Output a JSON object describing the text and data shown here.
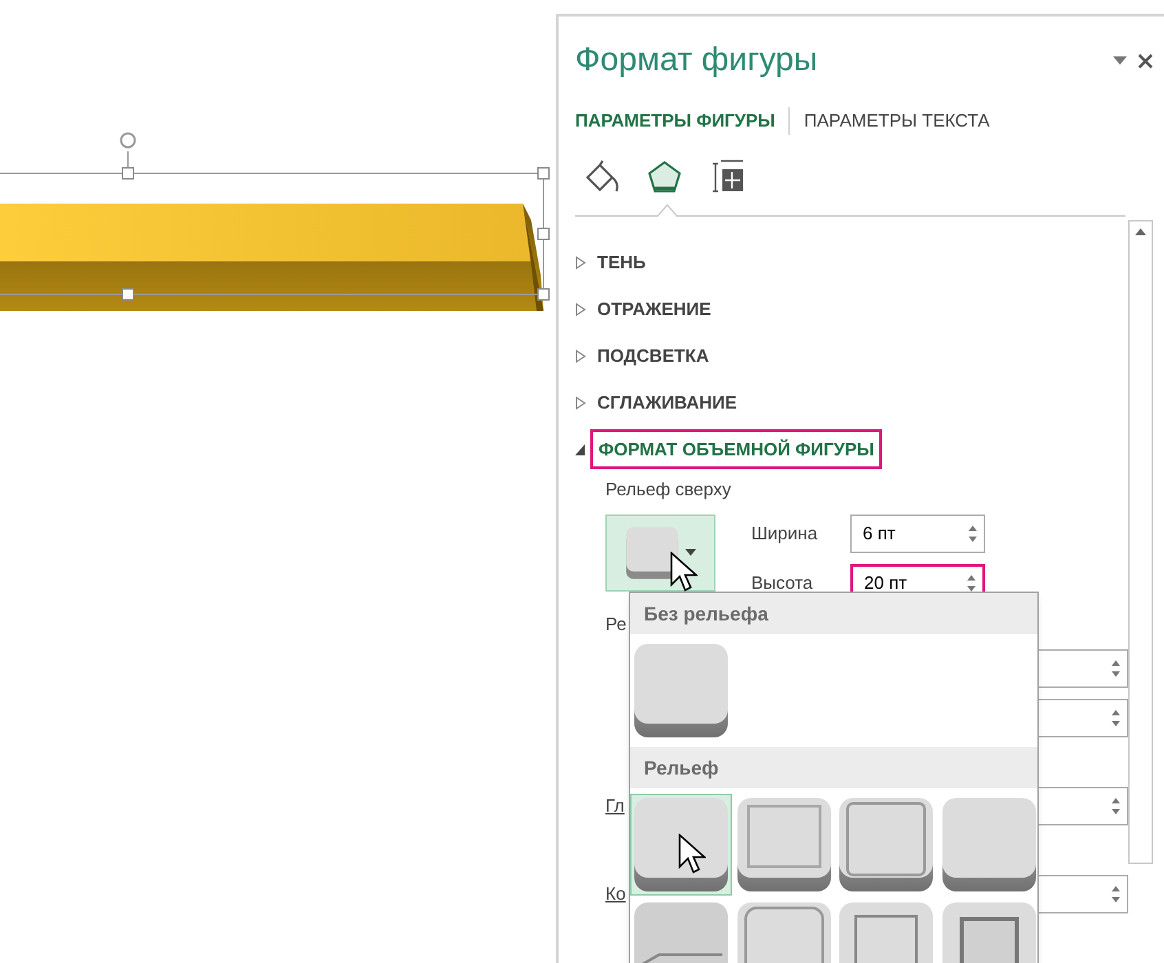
{
  "pane": {
    "title": "Формат фигуры",
    "tabs": [
      {
        "label": "ПАРАМЕТРЫ ФИГУРЫ",
        "selected": true
      },
      {
        "label": "ПАРАМЕТРЫ ТЕКСТА",
        "selected": false
      }
    ],
    "icon_tabs": [
      {
        "kind": "fill",
        "selected": false
      },
      {
        "kind": "effects",
        "selected": true
      },
      {
        "kind": "size",
        "selected": false
      }
    ],
    "sections": [
      {
        "label": "ТЕНЬ",
        "expanded": false,
        "highlighted": false
      },
      {
        "label": "ОТРАЖЕНИЕ",
        "expanded": false,
        "highlighted": false
      },
      {
        "label": "ПОДСВЕТКА",
        "expanded": false,
        "highlighted": false
      },
      {
        "label": "СГЛАЖИВАНИЕ",
        "expanded": false,
        "highlighted": false
      },
      {
        "label": "ФОРМАТ ОБЪЕМНОЙ ФИГУРЫ",
        "expanded": true,
        "highlighted": true
      }
    ],
    "bevel_top": {
      "label": "Рельеф сверху",
      "width_label": "Ширина",
      "width_value": "6 пт",
      "height_label": "Высота",
      "height_value": "20 пт",
      "height_highlighted": true
    },
    "cut_labels": [
      "Ре",
      "Гл",
      "Ко"
    ],
    "gallery": {
      "groups": [
        {
          "title": "Без рельефа",
          "items": [
            {
              "kind": "flat",
              "selected": false
            }
          ]
        },
        {
          "title": "Рельеф",
          "items": [
            {
              "kind": "round",
              "selected": true
            },
            {
              "kind": "inset",
              "selected": false
            },
            {
              "kind": "step",
              "selected": false
            },
            {
              "kind": "soft",
              "selected": false
            },
            {
              "kind": "angle",
              "selected": false
            },
            {
              "kind": "convex",
              "selected": false
            },
            {
              "kind": "frame",
              "selected": false
            },
            {
              "kind": "deep",
              "selected": false
            }
          ]
        }
      ]
    }
  }
}
